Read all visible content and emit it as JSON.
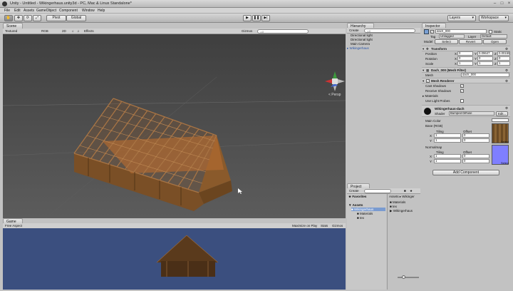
{
  "window": {
    "title": "Unity - Untitled - Wikingerhaus.unity3d - PC, Mac & Linux Standalone*"
  },
  "menu": [
    "File",
    "Edit",
    "Assets",
    "GameObject",
    "Component",
    "Window",
    "Help"
  ],
  "toolbar": {
    "pivot": "Pivot",
    "global": "Global",
    "layers": "Layers",
    "layout": "Workspace"
  },
  "scene": {
    "tab": "Scene",
    "shading": "Textured",
    "render": "RGB",
    "mode2d": "2D",
    "effects": "Effects",
    "gizmos": "Gizmos",
    "search": "All",
    "persp": "< Persp"
  },
  "game": {
    "tab": "Game",
    "aspect": "Free Aspect",
    "maximize": "Maximize on Play",
    "stats": "Stats",
    "gizmos": "Gizmos"
  },
  "hierarchy": {
    "tab": "Hierarchy",
    "create": "Create",
    "search": "All",
    "items": [
      "Directional light",
      "Directional light",
      "Main Camera",
      "Wikingerhaus"
    ]
  },
  "project": {
    "tab": "Project",
    "create": "Create",
    "favorites": "Favorites",
    "assets_label": "Assets",
    "path": "Assets ▸ Wikinger",
    "tree": [
      "Wikingerhaus",
      "Materials",
      "tex"
    ],
    "contents": [
      "Materials",
      "tex",
      "Wikingerhaus"
    ]
  },
  "inspector": {
    "tab": "Inspector",
    "name": "dach_000",
    "static": "Static",
    "tag_label": "Tag",
    "tag": "Untagged",
    "layer_label": "Layer",
    "layer": "Default",
    "model_label": "Model",
    "select": "Select",
    "revert": "Revert",
    "open": "Open",
    "transform": {
      "title": "Transform",
      "position": {
        "label": "Position",
        "x": "0",
        "y": "0.09647",
        "z": "0.00155"
      },
      "rotation": {
        "label": "Rotation",
        "x": "0",
        "y": "0",
        "z": "0"
      },
      "scale": {
        "label": "Scale",
        "x": "1",
        "y": "1",
        "z": "1"
      }
    },
    "filter": {
      "title": "Dach_000 (Mesh Filter)",
      "mesh_label": "Mesh",
      "mesh": "dach_000"
    },
    "renderer": {
      "title": "Mesh Renderer",
      "cast": "Cast Shadows",
      "receive": "Receive Shadows",
      "materials": "Materials",
      "probes": "Use Light Probes"
    },
    "material": {
      "name": "Wikingerhaus-dach",
      "shader_label": "Shader",
      "shader": "Bumped Diffuse",
      "edit": "Edit...",
      "main_color": "Main Color",
      "base": "Base (RGB)",
      "tiling": "Tiling",
      "offset": "Offset",
      "tile_x": "1",
      "tile_y": "1",
      "off_x": "0",
      "off_y": "0",
      "normalmap": "Normalmap",
      "tile2_x": "1",
      "tile2_y": "1",
      "off2_x": "0",
      "off2_y": "0",
      "select": "Select"
    },
    "add_component": "Add Component",
    "axes": {
      "x": "X",
      "y": "Y",
      "z": "Z"
    }
  }
}
